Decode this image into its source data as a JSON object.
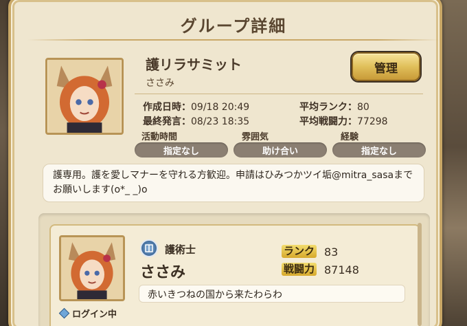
{
  "panel": {
    "title": "グループ詳細"
  },
  "group": {
    "name": "護リラサミット",
    "leader": "ささみ",
    "manage_label": "管理",
    "created_label": "作成日時：",
    "created_value": "09/18 20:49",
    "last_post_label": "最終発言：",
    "last_post_value": "08/23 18:35",
    "avg_rank_label": "平均ランク：",
    "avg_rank_value": "80",
    "avg_power_label": "平均戦闘力：",
    "avg_power_value": "77298",
    "categories": [
      {
        "label": "活動時間",
        "value": "指定なし"
      },
      {
        "label": "雰囲気",
        "value": "助け合い"
      },
      {
        "label": "経験",
        "value": "指定なし"
      }
    ],
    "description": "護専用。護を愛しマナーを守れる方歓迎。申請はひみつかツイ垢@mitra_sasaまでお願いします(o*_ _)o"
  },
  "member": {
    "class": "護術士",
    "name": "ささみ",
    "rank_label": "ランク",
    "rank_value": "83",
    "power_label": "戦闘力",
    "power_value": "87148",
    "comment": "赤いきつねの国から来たわらわ",
    "status": "ログイン中"
  },
  "colors": {
    "panel": "#efe6cf",
    "gold_button": "#e0bf5a",
    "pill": "#8b7f72"
  }
}
